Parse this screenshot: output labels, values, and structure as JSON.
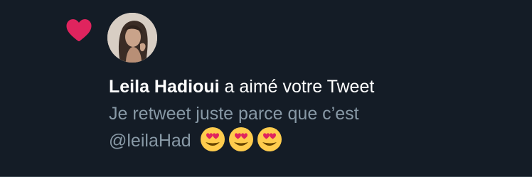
{
  "notification": {
    "icon": "heart-icon",
    "user_name": "Leila Hadioui",
    "action_text": "a aimé votre Tweet",
    "tweet_line_1": "Je retweet juste parce que c’est",
    "tweet_line_2": "@leilaHad",
    "emojis": [
      "heart-eyes-emoji",
      "heart-eyes-emoji",
      "heart-eyes-emoji"
    ]
  },
  "colors": {
    "background": "#141c26",
    "heart": "#e0245e",
    "primary_text": "#ffffff",
    "secondary_text": "#8899a6"
  }
}
